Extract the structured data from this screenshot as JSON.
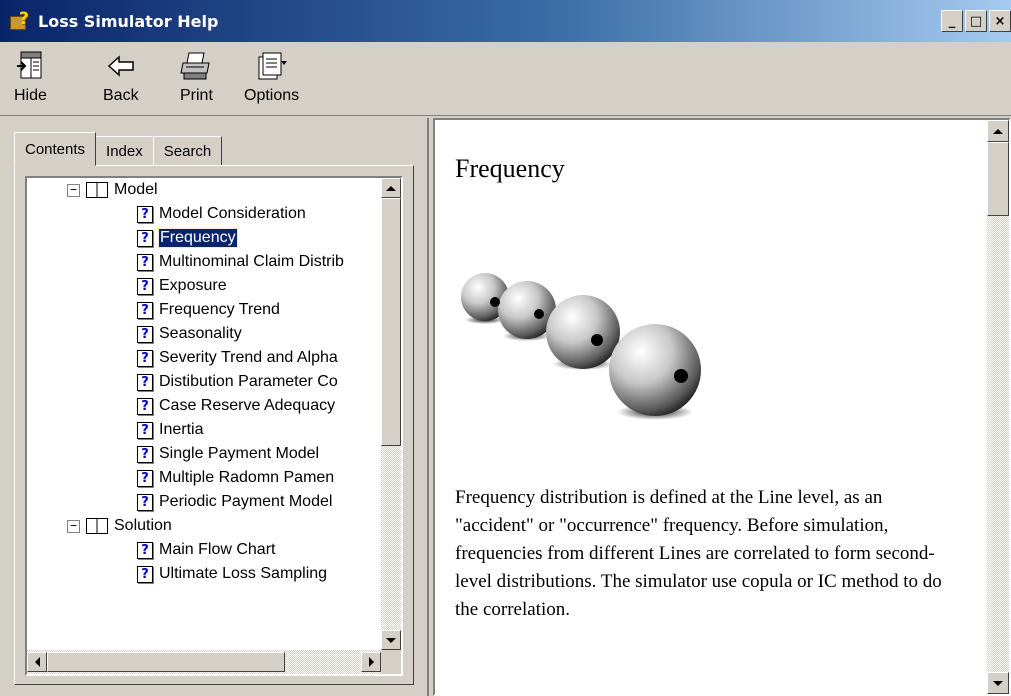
{
  "window": {
    "title": "Loss Simulator Help",
    "minimize_label": "_",
    "maximize_label": "□",
    "close_label": "×"
  },
  "toolbar": {
    "hide_label": "Hide",
    "back_label": "Back",
    "print_label": "Print",
    "options_label": "Options"
  },
  "tabs": {
    "contents": "Contents",
    "index": "Index",
    "search": "Search"
  },
  "tree": {
    "model_label": "Model",
    "model_items": [
      "Model Consideration",
      "Frequency",
      "Multinominal Claim Distrib",
      "Exposure",
      "Frequency Trend",
      "Seasonality",
      "Severity Trend and Alpha",
      "Distibution Parameter Co",
      "Case Reserve Adequacy",
      "Inertia",
      "Single Payment Model",
      "Multiple Radomn Pamen",
      "Periodic Payment Model"
    ],
    "solution_label": "Solution",
    "solution_items": [
      "Main Flow Chart",
      "Ultimate Loss Sampling"
    ],
    "expander_symbol": "−",
    "page_symbol": "?",
    "selected_item": "Frequency"
  },
  "topic": {
    "title": "Frequency",
    "body": "Frequency distribution is defined at the Line level, as an \"accident\" or \"occurrence\" frequency.  Before simulation, frequencies from different Lines are correlated to form second-level distributions. The simulator use copula or IC method to do the correlation."
  },
  "colors": {
    "titlebar_start": "#0a246a",
    "titlebar_end": "#a6caf0",
    "chrome": "#d4d0c8",
    "selection": "#0a246a"
  }
}
